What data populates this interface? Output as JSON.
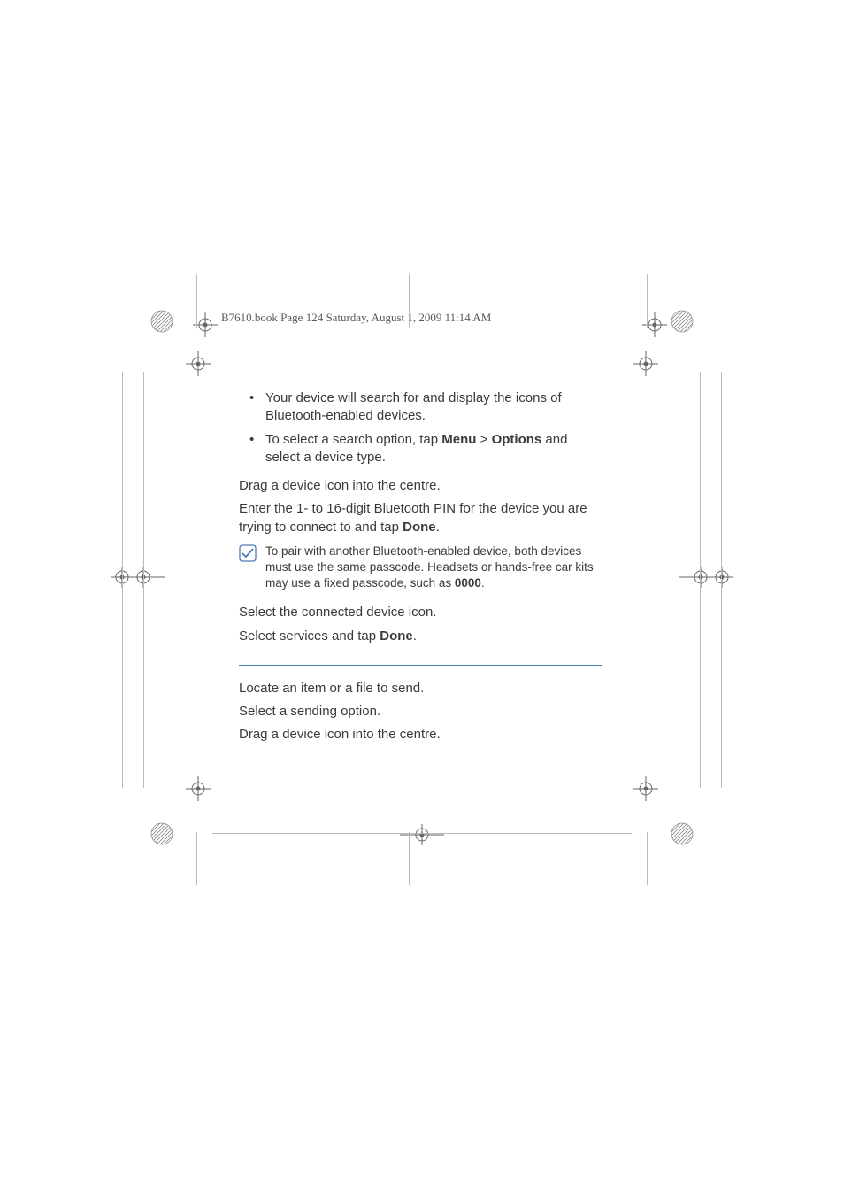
{
  "header": {
    "text": "B7610.book  Page 124  Saturday, August 1, 2009  11:14 AM"
  },
  "body": {
    "bullets": [
      "Your device will search for and display the icons of Bluetooth-enabled devices.",
      {
        "pre": "To select a search option, tap ",
        "b1": "Menu",
        "mid": " > ",
        "b2": "Options",
        "post": " and select a device type."
      }
    ],
    "p1": "Drag a device icon into the centre.",
    "p2_pre": "Enter the 1- to 16-digit Bluetooth PIN for the device you are trying to connect to and tap ",
    "p2_bold": "Done",
    "p2_post": ".",
    "note_pre": "To pair with another Bluetooth-enabled device, both devices must use the same passcode. Headsets or hands-free car kits may use a fixed passcode, such as ",
    "note_bold": "0000",
    "note_post": ".",
    "p3": "Select the connected device icon.",
    "p4_pre": "Select services and tap ",
    "p4_bold": "Done",
    "p4_post": ".",
    "s2_p1": "Locate an item or a file to send.",
    "s2_p2": "Select a sending option.",
    "s2_p3": "Drag a device icon into the centre."
  }
}
